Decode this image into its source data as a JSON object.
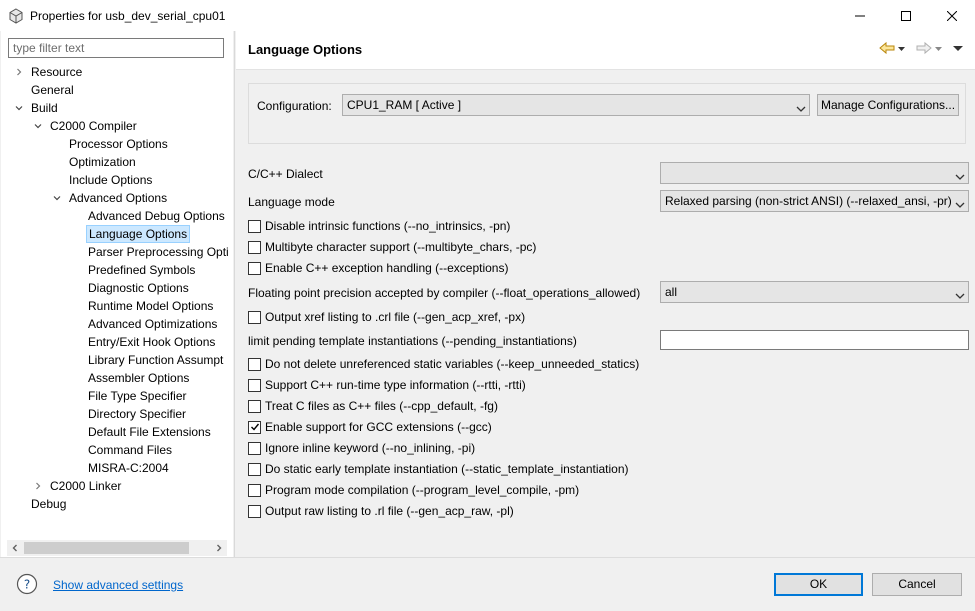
{
  "window": {
    "title": "Properties for usb_dev_serial_cpu01",
    "minimize_icon": "minimize-icon",
    "maximize_icon": "maximize-icon",
    "close_icon": "close-icon"
  },
  "left": {
    "filter_placeholder": "type filter text",
    "tree": [
      {
        "label": "Resource",
        "depth": 0,
        "expander": "collapsed"
      },
      {
        "label": "General",
        "depth": 0,
        "expander": "none"
      },
      {
        "label": "Build",
        "depth": 0,
        "expander": "expanded"
      },
      {
        "label": "C2000 Compiler",
        "depth": 1,
        "expander": "expanded"
      },
      {
        "label": "Processor Options",
        "depth": 2,
        "expander": "none"
      },
      {
        "label": "Optimization",
        "depth": 2,
        "expander": "none"
      },
      {
        "label": "Include Options",
        "depth": 2,
        "expander": "none"
      },
      {
        "label": "Advanced Options",
        "depth": 2,
        "expander": "expanded"
      },
      {
        "label": "Advanced Debug Options",
        "depth": 3,
        "expander": "none"
      },
      {
        "label": "Language Options",
        "depth": 3,
        "expander": "none",
        "selected": true
      },
      {
        "label": "Parser Preprocessing Opti",
        "depth": 3,
        "expander": "none"
      },
      {
        "label": "Predefined Symbols",
        "depth": 3,
        "expander": "none"
      },
      {
        "label": "Diagnostic Options",
        "depth": 3,
        "expander": "none"
      },
      {
        "label": "Runtime Model Options",
        "depth": 3,
        "expander": "none"
      },
      {
        "label": "Advanced Optimizations",
        "depth": 3,
        "expander": "none"
      },
      {
        "label": "Entry/Exit Hook Options",
        "depth": 3,
        "expander": "none"
      },
      {
        "label": "Library Function Assumpt",
        "depth": 3,
        "expander": "none"
      },
      {
        "label": "Assembler Options",
        "depth": 3,
        "expander": "none"
      },
      {
        "label": "File Type Specifier",
        "depth": 3,
        "expander": "none"
      },
      {
        "label": "Directory Specifier",
        "depth": 3,
        "expander": "none"
      },
      {
        "label": "Default File Extensions",
        "depth": 3,
        "expander": "none"
      },
      {
        "label": "Command Files",
        "depth": 3,
        "expander": "none"
      },
      {
        "label": "MISRA-C:2004",
        "depth": 3,
        "expander": "none"
      },
      {
        "label": "C2000 Linker",
        "depth": 1,
        "expander": "collapsed"
      },
      {
        "label": "Debug",
        "depth": 0,
        "expander": "none"
      }
    ]
  },
  "page": {
    "title": "Language Options",
    "configuration_label": "Configuration:",
    "configuration_value": "CPU1_RAM  [ Active ]",
    "manage_button": "Manage Configurations...",
    "dialect_label": "C/C++ Dialect",
    "dialect_value": "",
    "language_mode_label": "Language mode",
    "language_mode_value": "Relaxed parsing (non-strict ANSI) (--relaxed_ansi, -pr)",
    "fp_label": "Floating point precision accepted by compiler (--float_operations_allowed)",
    "fp_value": "all",
    "pending_label": "limit pending template instantiations (--pending_instantiations)",
    "pending_value": "",
    "checkboxes_a": [
      {
        "label": "Disable intrinsic functions (--no_intrinsics, -pn)",
        "checked": false
      },
      {
        "label": "Multibyte character support (--multibyte_chars, -pc)",
        "checked": false
      },
      {
        "label": "Enable C++ exception handling (--exceptions)",
        "checked": false
      }
    ],
    "checkbox_xref": {
      "label": "Output xref listing to .crl file (--gen_acp_xref, -px)",
      "checked": false
    },
    "checkboxes_b": [
      {
        "label": "Do not delete unreferenced static variables (--keep_unneeded_statics)",
        "checked": false
      },
      {
        "label": "Support C++ run-time type information (--rtti, -rtti)",
        "checked": false
      },
      {
        "label": "Treat C files as C++ files (--cpp_default, -fg)",
        "checked": false
      },
      {
        "label": "Enable support for GCC extensions (--gcc)",
        "checked": true
      },
      {
        "label": "Ignore inline keyword (--no_inlining, -pi)",
        "checked": false
      },
      {
        "label": "Do static early template instantiation (--static_template_instantiation)",
        "checked": false
      },
      {
        "label": "Program mode compilation (--program_level_compile, -pm)",
        "checked": false
      },
      {
        "label": "Output raw listing to .rl file (--gen_acp_raw, -pl)",
        "checked": false
      }
    ]
  },
  "bottom": {
    "show_advanced": "Show advanced settings",
    "ok": "OK",
    "cancel": "Cancel"
  },
  "colors": {
    "selection_bg": "#cce8ff",
    "link": "#0066cc",
    "accent": "#0078d7"
  }
}
